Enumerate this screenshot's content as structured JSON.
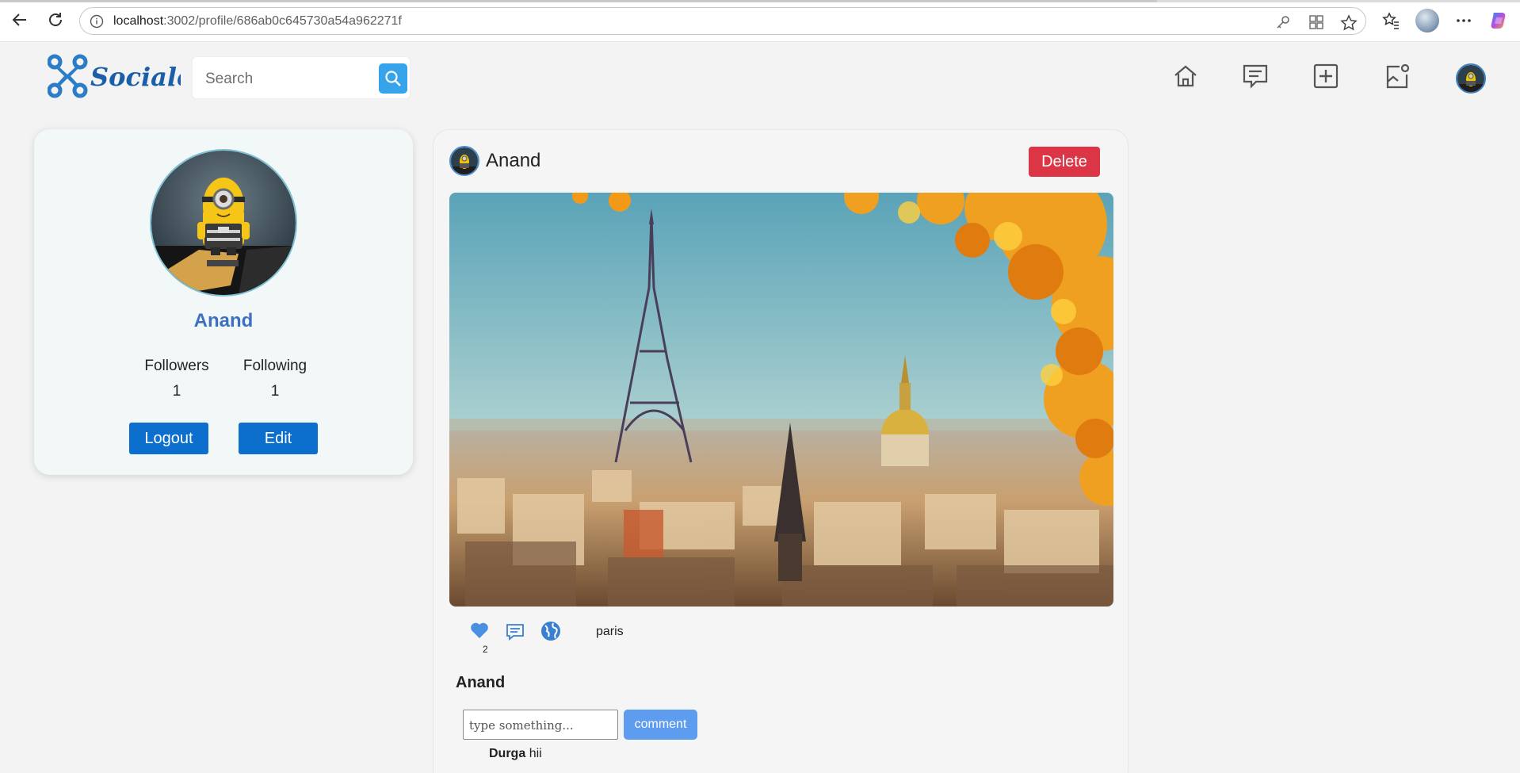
{
  "browser": {
    "url_host": "localhost",
    "url_rest": ":3002/profile/686ab0c645730a54a962271f",
    "icons": [
      "back-icon",
      "refresh-icon",
      "info-icon",
      "key-icon",
      "apps-icon",
      "star-icon",
      "favorites-icon",
      "profile-icon",
      "more-icon",
      "copilot-icon"
    ]
  },
  "header": {
    "logo_text": "SocialeX",
    "search_placeholder": "Search",
    "nav_icons": [
      "home-icon",
      "chat-icon",
      "add-icon",
      "notification-icon"
    ]
  },
  "profile": {
    "name": "Anand",
    "followers_label": "Followers",
    "followers_count": "1",
    "following_label": "Following",
    "following_count": "1",
    "logout_label": "Logout",
    "edit_label": "Edit"
  },
  "post": {
    "author": "Anand",
    "delete_label": "Delete",
    "likes": "2",
    "location": "paris",
    "caption_author": "Anand",
    "comment_placeholder": "type something...",
    "comment_button": "comment",
    "comments": [
      {
        "user": "Durga",
        "text": "hii"
      }
    ]
  },
  "colors": {
    "accent_blue": "#0c6fcd",
    "delete_red": "#dc3545",
    "search_button": "#36a3ea",
    "comment_button": "#5e9cf0",
    "name_blue": "#3f6fc0"
  }
}
